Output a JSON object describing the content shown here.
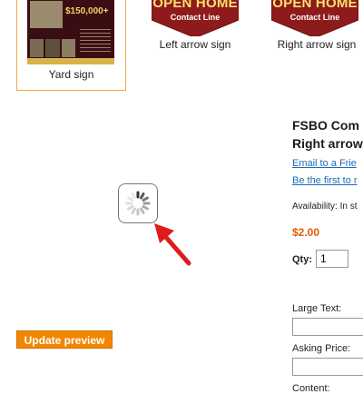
{
  "thumbnails": [
    {
      "caption": "Yard sign",
      "selected": true
    },
    {
      "caption": "Left arrow sign",
      "selected": false,
      "sign_title": "OPEN HOME",
      "sign_sub": "Contact Line"
    },
    {
      "caption": "Right arrow sign",
      "selected": false,
      "sign_title": "OPEN HOME",
      "sign_sub": "Contact Line"
    }
  ],
  "yard_sign_price": "$150,000+",
  "preview": {
    "loading_icon": "spinner-icon",
    "annotation": "red-arrow-icon",
    "update_button": "Update preview"
  },
  "product": {
    "title_line1": "FSBO Com",
    "title_line2": "Right arrow",
    "email_link": "Email to a Frie",
    "review_link": "Be the first to r",
    "availability": "Availability: In st",
    "price": "$2.00",
    "qty_label": "Qty:",
    "qty_value": "1",
    "fields": [
      {
        "label": "Large Text:"
      },
      {
        "label": "Asking Price:"
      },
      {
        "label": "Content:"
      }
    ]
  },
  "colors": {
    "accent": "#f18700",
    "link": "#1e6bb8",
    "price": "#dd5b00",
    "sign_red": "#8e1b1b",
    "sign_yellow": "#fbe16b"
  }
}
